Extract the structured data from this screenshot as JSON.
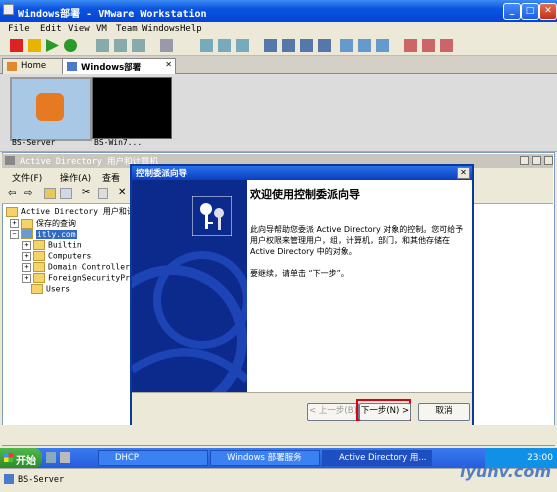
{
  "vmware": {
    "title": "Windows部署 - VMware Workstation",
    "menu": [
      "File",
      "Edit",
      "View",
      "VM",
      "Team",
      "Windows",
      "Help"
    ],
    "tabs": [
      {
        "label": "Home"
      },
      {
        "label": "Windows部署"
      }
    ],
    "thumbnails": [
      {
        "label": "BS-Server"
      },
      {
        "label": "BS-Win7..."
      }
    ],
    "status_label": "BS-Server"
  },
  "aduc": {
    "title": "Active Directory 用户和计算机",
    "menu": [
      "文件(F)",
      "操作(A)",
      "查看"
    ],
    "tree": {
      "root": "Active Directory 用户和计算机",
      "saved_queries": "保存的查询",
      "domain": "itly.com",
      "children": [
        "Builtin",
        "Computers",
        "Domain Controllers",
        "ForeignSecurityPrinc",
        "Users"
      ]
    }
  },
  "wizard": {
    "title": "控制委派向导",
    "heading": "欢迎使用控制委派向导",
    "body": "此向导帮助您委派 Active Directory 对象的控制。您可给予用户权限来管理用户，组，计算机，部门，和其他存储在 Active Directory 中的对象。",
    "continue": "要继续，请单击 “下一步”。",
    "buttons": {
      "back": "< 上一步(B)",
      "next": "下一步(N) >",
      "cancel": "取消"
    }
  },
  "taskbar": {
    "start": "开始",
    "tasks": [
      "DHCP",
      "Windows 部署服务",
      "Active Directory 用..."
    ],
    "clock": "23:00"
  },
  "watermark": "iyunv.com",
  "colors": {
    "xp_blue": "#0a54e0",
    "highlight": "#d9001b",
    "wizard_side": "#0b2a8c"
  }
}
